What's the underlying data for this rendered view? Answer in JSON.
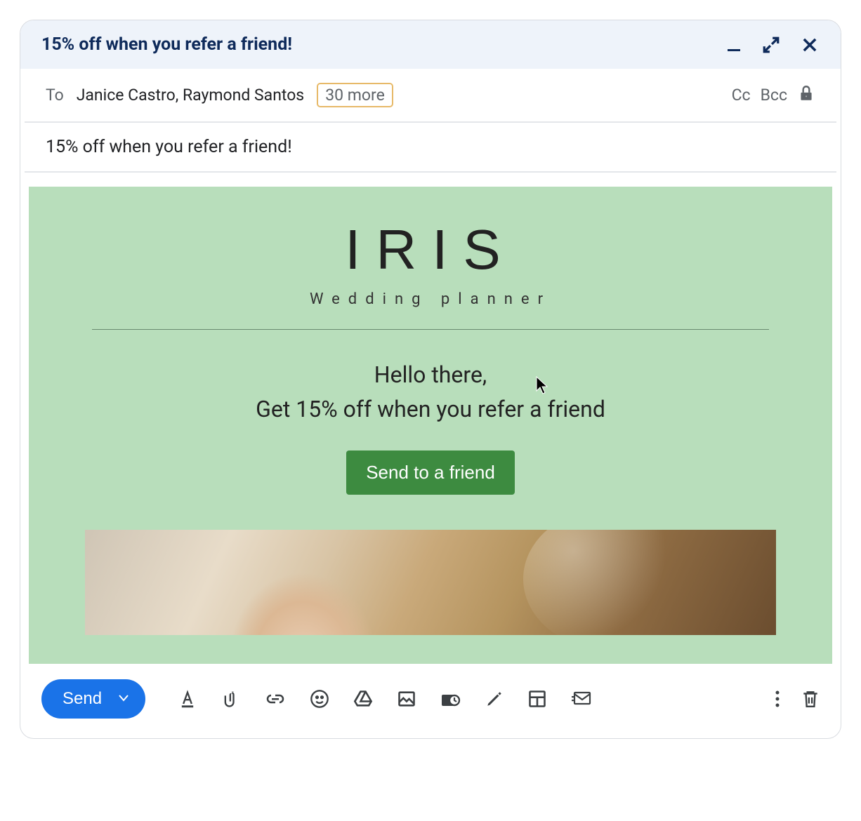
{
  "header": {
    "title": "15% off when you refer a friend!"
  },
  "to": {
    "label": "To",
    "recipients": "Janice Castro, Raymond Santos",
    "more_count": "30 more",
    "cc": "Cc",
    "bcc": "Bcc"
  },
  "subject": "15% off when you refer a friend!",
  "template": {
    "logo": "IRIS",
    "logo_sub": "Wedding planner",
    "greeting_line1": "Hello there,",
    "greeting_line2": "Get 15% off when you refer a friend",
    "cta": "Send to a friend"
  },
  "toolbar": {
    "send": "Send"
  },
  "icons": {
    "minimize": "minimize",
    "expand": "expand",
    "close": "close",
    "lock": "lock",
    "format": "format-text",
    "attach": "attach",
    "link": "link",
    "emoji": "emoji",
    "drive": "drive",
    "image": "image",
    "confidential": "confidential",
    "pen": "pen",
    "layout": "layout",
    "mail": "mail",
    "more": "more",
    "trash": "trash"
  }
}
